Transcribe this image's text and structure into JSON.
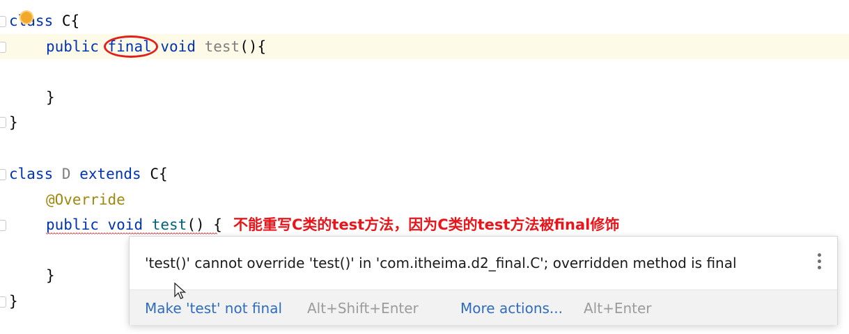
{
  "code": {
    "line1": {
      "kw": "class",
      "name": " C{"
    },
    "line2": {
      "kw1": "public",
      "kw2": "final",
      "kw3": "void",
      "fn": "test",
      "rest": "(){"
    },
    "line4": "}",
    "line5": "}",
    "line7": {
      "kw1": "class",
      "name": "D",
      "kw2": "extends",
      "rest": "C{"
    },
    "line8": "@Override",
    "line9": {
      "kw1": "public",
      "kw2": "void",
      "fn": "test",
      "rest": "() {"
    },
    "line11": "}",
    "line12": "}"
  },
  "annotation_note": "不能重写C类的test方法，因为C类的test方法被final修饰",
  "popup": {
    "message": "'test()' cannot override 'test()' in 'com.itheima.d2_final.C'; overridden method is final",
    "action1_label": "Make 'test' not final",
    "action1_shortcut": "Alt+Shift+Enter",
    "action2_label": "More actions...",
    "action2_shortcut": "Alt+Enter"
  },
  "colors": {
    "keyword": "#0033b3",
    "method": "#00627a",
    "annotation": "#9e880d",
    "error_note": "#e8161b",
    "link": "#2f6cbd"
  },
  "icons": [
    "intention-bulb-icon",
    "more-options-icon",
    "mouse-cursor-icon",
    "fold-marker-icon"
  ]
}
